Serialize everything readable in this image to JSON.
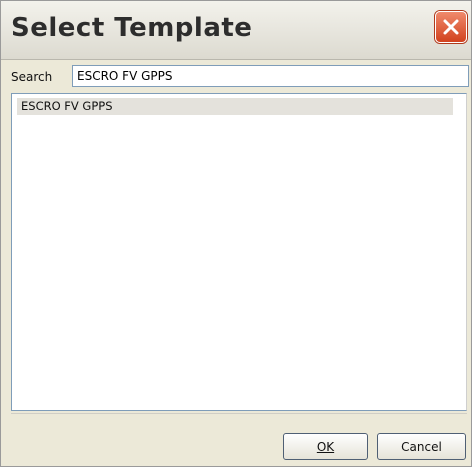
{
  "window": {
    "title": "Select Template"
  },
  "search": {
    "label": "Search",
    "value": "ESCRO FV GPPS"
  },
  "list": {
    "items": [
      {
        "label": "ESCRO FV GPPS",
        "selected": true
      }
    ]
  },
  "buttons": {
    "ok_label": "OK",
    "cancel_label": "Cancel"
  },
  "icons": {
    "close": "close-icon"
  },
  "colors": {
    "close_button": "#d2421e",
    "window_bg": "#ece9d8",
    "selection": "#e4e2dc"
  }
}
